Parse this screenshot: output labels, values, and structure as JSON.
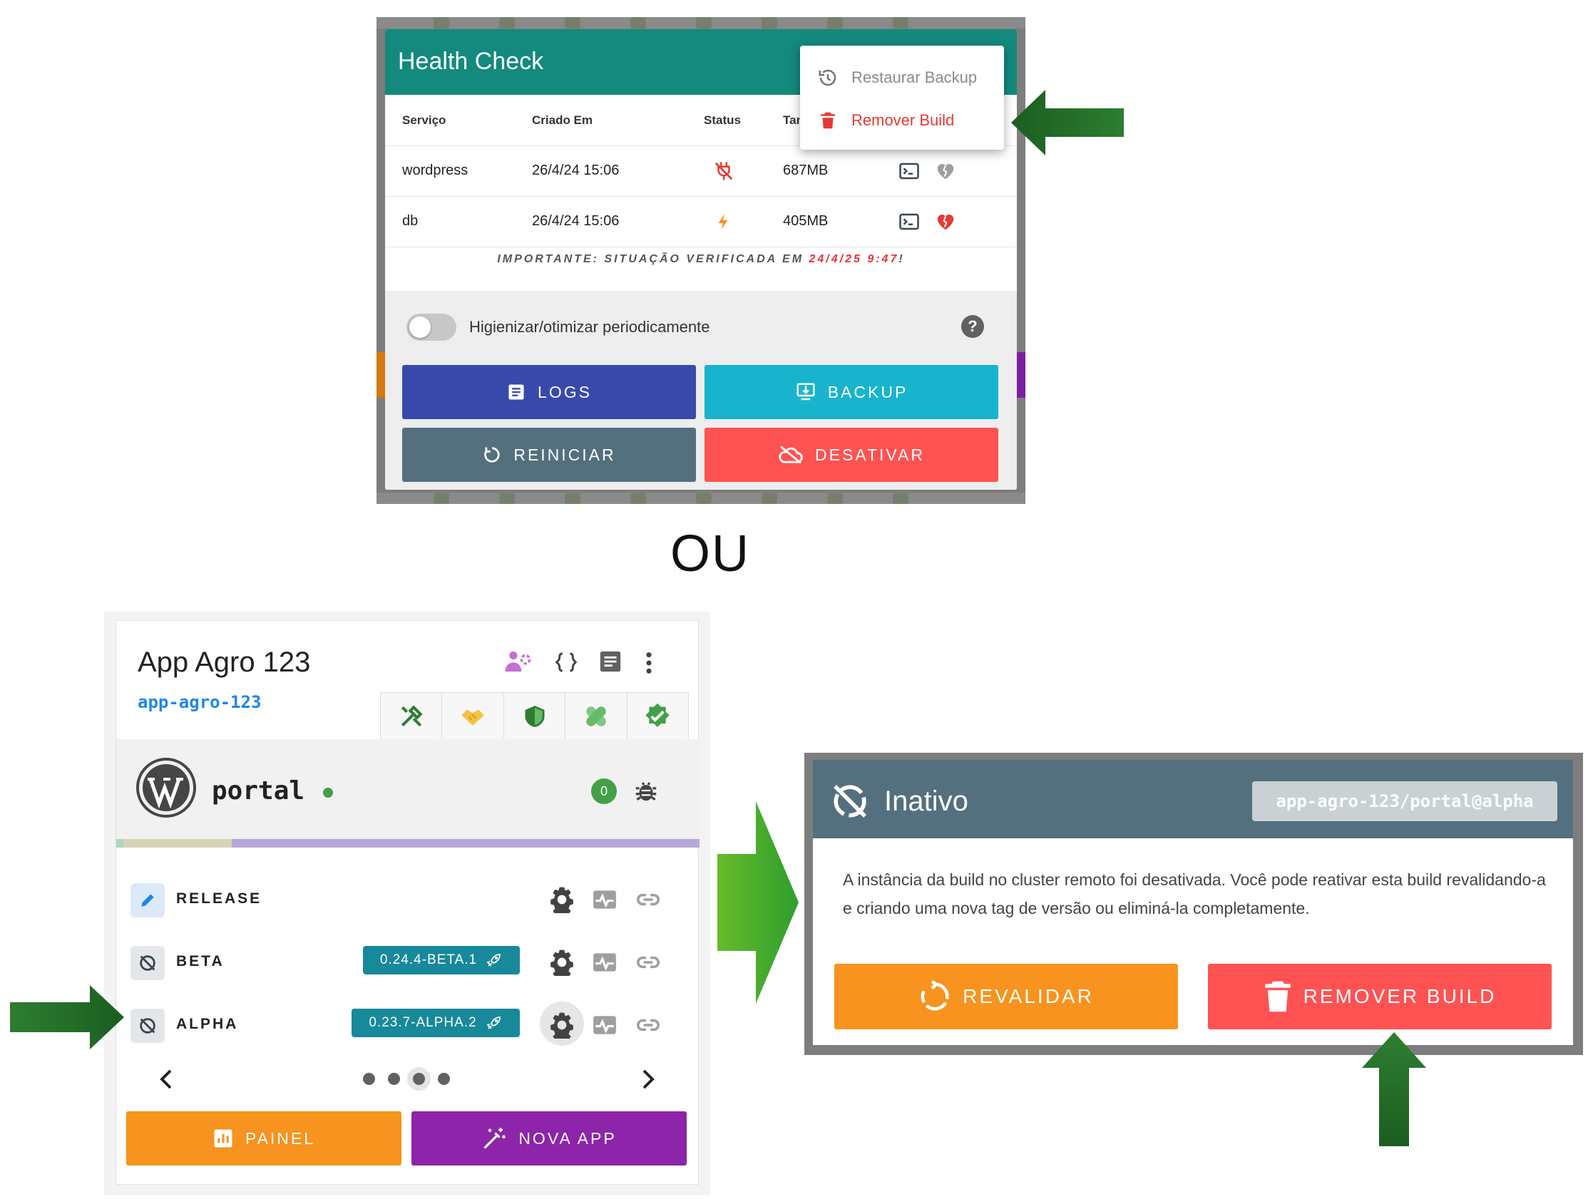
{
  "health_check": {
    "title": "Health Check",
    "columns": [
      "Serviço",
      "Criado Em",
      "Status",
      "Tam"
    ],
    "rows": [
      {
        "service": "wordpress",
        "created": "26/4/24 15:06",
        "size": "687MB"
      },
      {
        "service": "db",
        "created": "26/4/24 15:06",
        "size": "405MB"
      }
    ],
    "note_prefix": "IMPORTANTE: SITUAÇÃO VERIFICADA EM ",
    "note_date": "24/4/25 9:47",
    "note_suffix": "!",
    "toggle_label": "Higienizar/otimizar periodicamente",
    "help": "?",
    "buttons": {
      "logs": "LOGS",
      "backup": "BACKUP",
      "reiniciar": "REINICIAR",
      "desativar": "DESATIVAR"
    },
    "menu": {
      "restore": "Restaurar Backup",
      "remove": "Remover Build"
    }
  },
  "separator": "OU",
  "app_card": {
    "title": "App Agro 123",
    "slug": "app-agro-123",
    "service": "portal",
    "count": "0",
    "environments": [
      {
        "label": "RELEASE",
        "version": ""
      },
      {
        "label": "BETA",
        "version": "0.24.4-BETA.1"
      },
      {
        "label": "ALPHA",
        "version": "0.23.7-ALPHA.2"
      }
    ],
    "buttons": {
      "painel": "PAINEL",
      "nova_app": "NOVA APP"
    }
  },
  "inactive_card": {
    "title": "Inativo",
    "chip": "app-agro-123/portal@alpha",
    "text": "A instância da build no cluster remoto foi desativada. Você pode reativar esta build revalidando-a e criando uma nova tag de versão ou eliminá-la completamente.",
    "buttons": {
      "revalidar": "REVALIDAR",
      "remover": "REMOVER BUILD"
    }
  },
  "colors": {
    "teal": "#138a7d",
    "indigo": "#3949ab",
    "cyan": "#18b4cd",
    "slate": "#546f7d",
    "red": "#ff5252",
    "orange": "#f7931e",
    "purple": "#8e24aa",
    "arrow_green": "#2e7d32"
  }
}
